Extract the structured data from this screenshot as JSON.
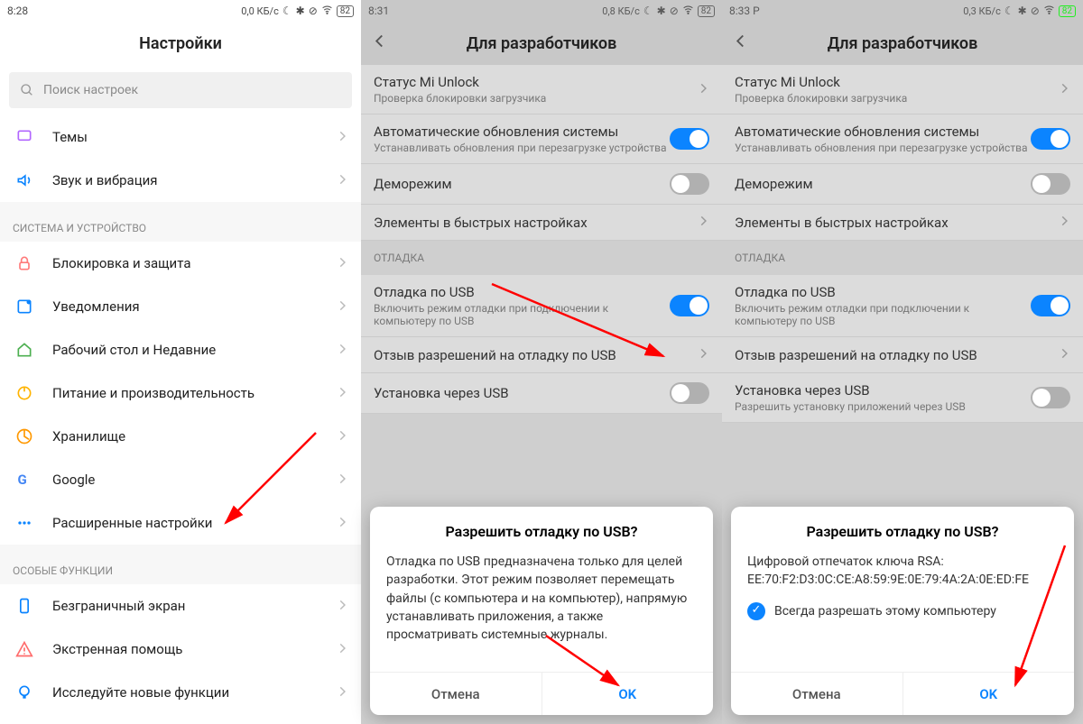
{
  "phone1": {
    "status_time": "8:28",
    "status_speed": "0,0 КБ/с",
    "status_battery": "82",
    "header": "Настройки",
    "search_placeholder": "Поиск настроек",
    "items_a": [
      {
        "label": "Темы",
        "icon": "theme",
        "color": "#b266ff"
      },
      {
        "label": "Звук и вибрация",
        "icon": "sound",
        "color": "#0b84ff"
      }
    ],
    "section_b": "СИСТЕМА И УСТРОЙСТВО",
    "items_b": [
      {
        "label": "Блокировка и защита",
        "icon": "lock",
        "color": "#ff7a7a"
      },
      {
        "label": "Уведомления",
        "icon": "notif",
        "color": "#0b84ff"
      },
      {
        "label": "Рабочий стол и Недавние",
        "icon": "home",
        "color": "#4caf50"
      },
      {
        "label": "Питание и производительность",
        "icon": "power",
        "color": "#ffb300"
      },
      {
        "label": "Хранилище",
        "icon": "storage",
        "color": "#ff9800"
      },
      {
        "label": "Google",
        "icon": "google",
        "color": "#4285f4"
      },
      {
        "label": "Расширенные настройки",
        "icon": "more",
        "color": "#0b84ff"
      }
    ],
    "section_c": "ОСОБЫЕ ФУНКЦИИ",
    "items_c": [
      {
        "label": "Безграничный экран",
        "icon": "screen",
        "color": "#0b84ff"
      },
      {
        "label": "Экстренная помощь",
        "icon": "sos",
        "color": "#ff6b6b"
      },
      {
        "label": "Исследуйте новые функции",
        "icon": "tip",
        "color": "#0b84ff"
      }
    ]
  },
  "phone2": {
    "status_time": "8:31",
    "status_speed": "0,8 КБ/с",
    "status_battery": "82",
    "header": "Для разработчиков",
    "rows": [
      {
        "title": "Статус Mi Unlock",
        "sub": "Проверка блокировки загрузчика",
        "kind": "nav"
      },
      {
        "title": "Автоматические обновления системы",
        "sub": "Устанавливать обновления при перезагрузке устройства",
        "kind": "toggle",
        "on": true
      },
      {
        "title": "Деморежим",
        "sub": "",
        "kind": "toggle",
        "on": false
      },
      {
        "title": "Элементы в быстрых настройках",
        "sub": "",
        "kind": "nav"
      }
    ],
    "section_debug": "ОТЛАДКА",
    "rows_debug": [
      {
        "title": "Отладка по USB",
        "sub": "Включить режим отладки при подключении к компьютеру по USB",
        "kind": "toggle",
        "on": true
      },
      {
        "title": "Отзыв разрешений на отладку по USB",
        "sub": "",
        "kind": "nav"
      },
      {
        "title": "Установка через USB",
        "sub": "",
        "kind": "toggle",
        "on": false
      }
    ],
    "dialog": {
      "title": "Разрешить отладку по USB?",
      "body": "Отладка по USB предназначена только для целей разработки. Этот режим позволяет перемещать файлы (с компьютера и на компьютер), напрямую устанавливать приложения, а также просматривать системные журналы.",
      "cancel": "Отмена",
      "ok": "OK"
    }
  },
  "phone3": {
    "status_time": "8:33",
    "status_indicator": "P",
    "status_speed": "0,3 КБ/с",
    "status_battery": "82",
    "header": "Для разработчиков",
    "rows": [
      {
        "title": "Статус Mi Unlock",
        "sub": "Проверка блокировки загрузчика",
        "kind": "nav"
      },
      {
        "title": "Автоматические обновления системы",
        "sub": "Устанавливать обновления при перезагрузке устройства",
        "kind": "toggle",
        "on": true
      },
      {
        "title": "Деморежим",
        "sub": "",
        "kind": "toggle",
        "on": false
      },
      {
        "title": "Элементы в быстрых настройках",
        "sub": "",
        "kind": "nav"
      }
    ],
    "section_debug": "ОТЛАДКА",
    "rows_debug": [
      {
        "title": "Отладка по USB",
        "sub": "Включить режим отладки при подключении к компьютеру по USB",
        "kind": "toggle",
        "on": true
      },
      {
        "title": "Отзыв разрешений на отладку по USB",
        "sub": "",
        "kind": "nav"
      },
      {
        "title": "Установка через USB",
        "sub": "Разрешить установку приложений через USB",
        "kind": "toggle",
        "on": false
      }
    ],
    "dialog": {
      "title": "Разрешить отладку по USB?",
      "fingerprint_label": "Цифровой отпечаток ключа RSA:",
      "fingerprint": "EE:70:F2:D3:0C:CE:A8:59:9E:0E:79:4A:2A:0E:ED:FE",
      "always": "Всегда разрешать этому компьютеру",
      "cancel": "Отмена",
      "ok": "OK"
    }
  }
}
